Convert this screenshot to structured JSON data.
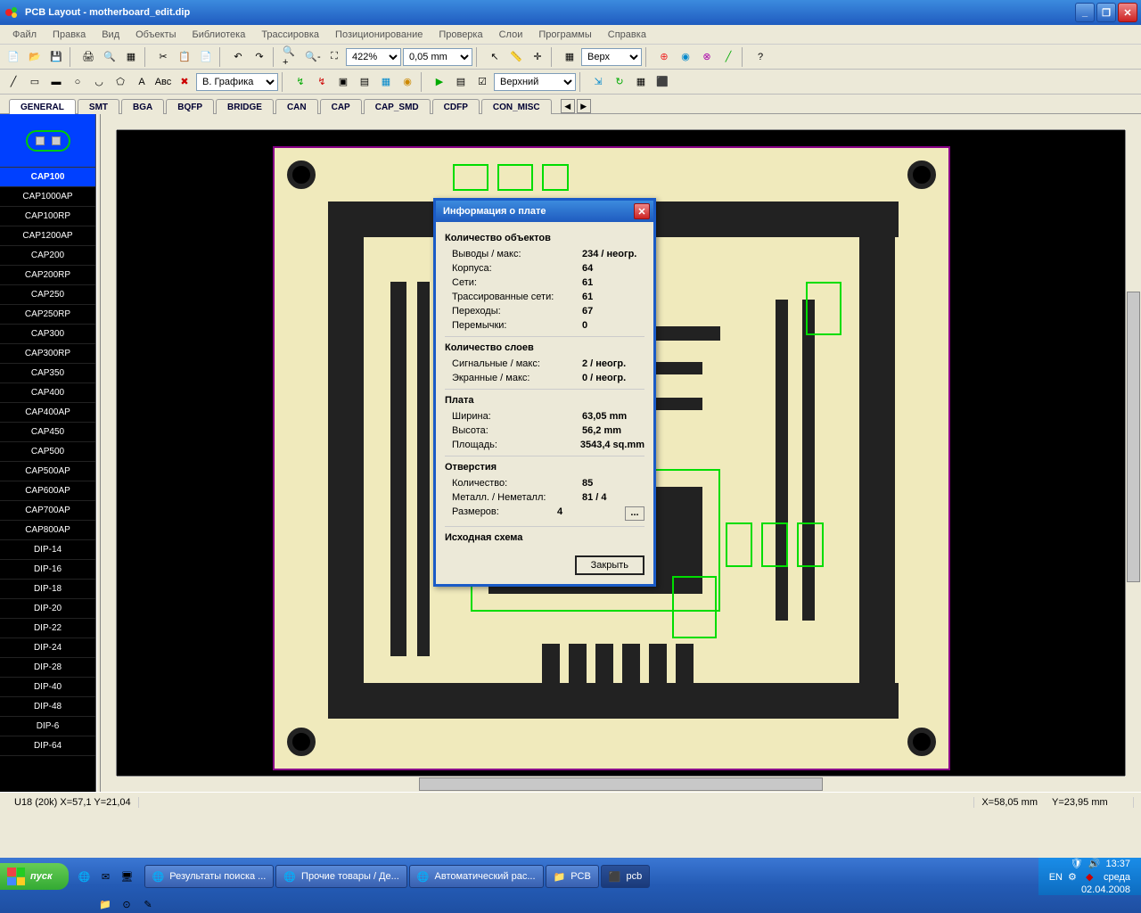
{
  "title": "PCB Layout - motherboard_edit.dip",
  "menu": [
    "Файл",
    "Правка",
    "Вид",
    "Объекты",
    "Библиотека",
    "Трассировка",
    "Позиционирование",
    "Проверка",
    "Слои",
    "Программы",
    "Справка"
  ],
  "toolbar1": {
    "zoom": "422%",
    "grid": "0,05 mm",
    "layer": "Верх"
  },
  "toolbar2": {
    "view": "В. Графика",
    "layer2": "Верхний"
  },
  "tabs": [
    "GENERAL",
    "SMT",
    "BGA",
    "BQFP",
    "BRIDGE",
    "CAN",
    "CAP",
    "CAP_SMD",
    "CDFP",
    "CON_MISC"
  ],
  "components": [
    "CAP100",
    "CAP1000AP",
    "CAP100RP",
    "CAP1200AP",
    "CAP200",
    "CAP200RP",
    "CAP250",
    "CAP250RP",
    "CAP300",
    "CAP300RP",
    "CAP350",
    "CAP400",
    "CAP400AP",
    "CAP450",
    "CAP500",
    "CAP500AP",
    "CAP600AP",
    "CAP700AP",
    "CAP800AP",
    "DIP-14",
    "DIP-16",
    "DIP-18",
    "DIP-20",
    "DIP-22",
    "DIP-24",
    "DIP-28",
    "DIP-40",
    "DIP-48",
    "DIP-6",
    "DIP-64"
  ],
  "selectedComp": "CAP100",
  "dialog": {
    "title": "Информация о плате",
    "groups": [
      {
        "head": "Количество объектов",
        "rows": [
          {
            "lbl": "Выводы / макс:",
            "val": "234 / неогр."
          },
          {
            "lbl": "Корпуса:",
            "val": "64"
          },
          {
            "lbl": "Сети:",
            "val": "61"
          },
          {
            "lbl": "Трассированные сети:",
            "val": "61"
          },
          {
            "lbl": "Переходы:",
            "val": "67"
          },
          {
            "lbl": "Перемычки:",
            "val": "0"
          }
        ]
      },
      {
        "head": "Количество слоев",
        "rows": [
          {
            "lbl": "Сигнальные / макс:",
            "val": "2 / неогр."
          },
          {
            "lbl": "Экранные / макс:",
            "val": "0 / неогр."
          }
        ]
      },
      {
        "head": "Плата",
        "rows": [
          {
            "lbl": "Ширина:",
            "val": "63,05 mm"
          },
          {
            "lbl": "Высота:",
            "val": "56,2 mm"
          },
          {
            "lbl": "Площадь:",
            "val": "3543,4 sq.mm"
          }
        ]
      },
      {
        "head": "Отверстия",
        "rows": [
          {
            "lbl": "Количество:",
            "val": "85"
          },
          {
            "lbl": "Металл. / Неметалл:",
            "val": "81 / 4"
          },
          {
            "lbl": "Размеров:",
            "val": "4",
            "btn": "..."
          }
        ]
      },
      {
        "head": "Исходная схема",
        "rows": []
      }
    ],
    "closeBtn": "Закрыть"
  },
  "status": {
    "left": "U18 (20k)  X=57,1  Y=21,04",
    "x": "X=58,05 mm",
    "y": "Y=23,95 mm"
  },
  "taskbar": {
    "start": "пуск",
    "tasks": [
      "Результаты поиска ...",
      "Прочие товары / Де...",
      "Автоматический рас...",
      "PCB",
      "pcb"
    ],
    "tray": {
      "lang": "EN",
      "time": "13:37",
      "date": "02.04.2008",
      "day": "среда"
    }
  }
}
